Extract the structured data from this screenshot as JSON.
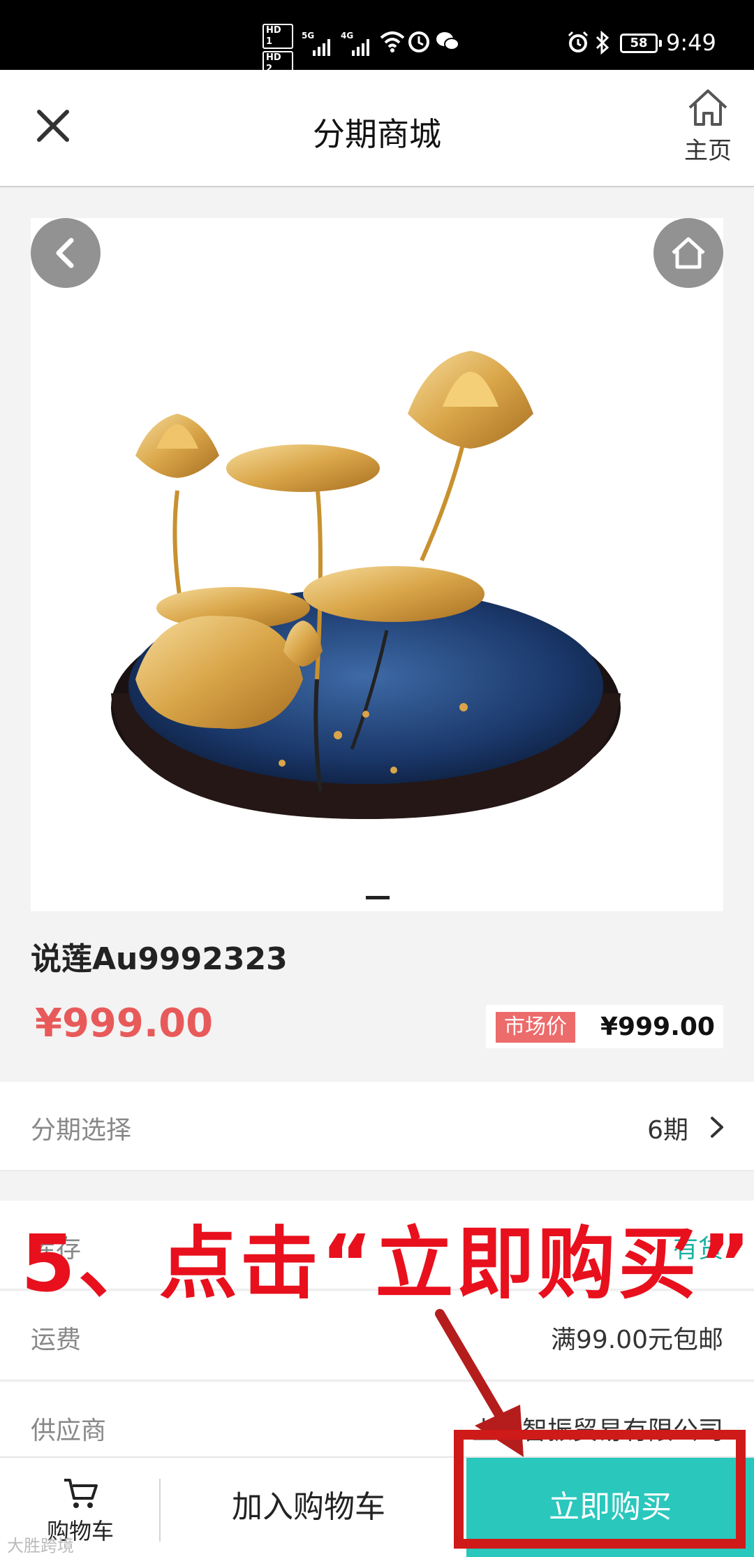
{
  "status_bar": {
    "hd1": "HD 1",
    "hd2": "HD 2",
    "net1": "5G",
    "net2": "4G",
    "battery": "58",
    "time": "9:49"
  },
  "header": {
    "title": "分期商城",
    "home_label": "主页"
  },
  "product": {
    "name": "说莲Au9992323",
    "price": "¥999.00",
    "market_label": "市场价",
    "market_price": "¥999.00"
  },
  "rows": {
    "installment": {
      "label": "分期选择",
      "value": "6期"
    },
    "stock": {
      "label": "库存",
      "value": "有货"
    },
    "shipping": {
      "label": "运费",
      "value": "满99.00元包邮"
    },
    "supplier": {
      "label": "供应商",
      "value": "上海智振贸易有限公司"
    }
  },
  "annotation": {
    "text": "5、点击“立即购买”"
  },
  "bottom_bar": {
    "cart_label": "购物车",
    "add_to_cart": "加入购物车",
    "buy_now": "立即购买"
  },
  "watermark": "大胜跨境",
  "colors": {
    "accent": "#2ac7bd",
    "price": "#e85a5a",
    "annotation": "#e8101d"
  }
}
